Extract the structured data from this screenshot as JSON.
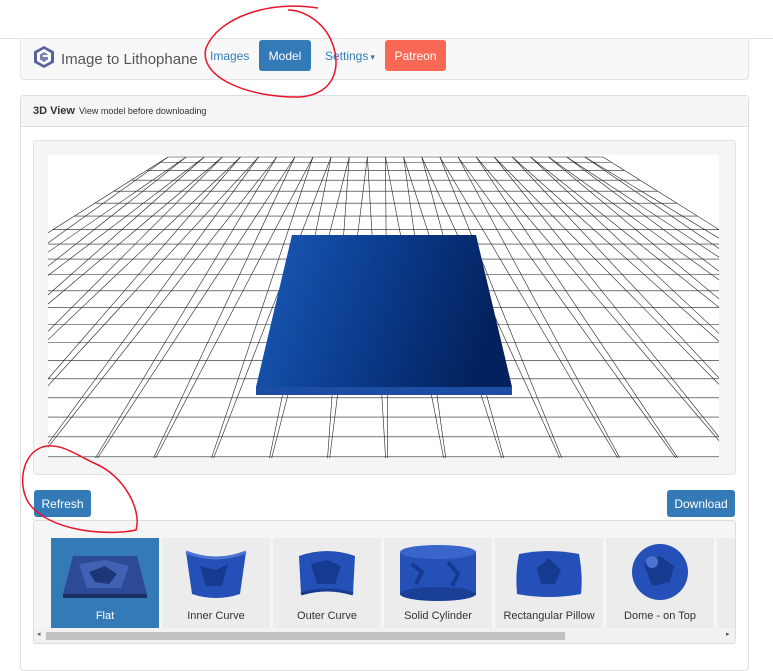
{
  "brand": {
    "title": "Image to Lithophane",
    "logo_icon": "lithophane-logo-icon"
  },
  "nav": {
    "images_label": "Images",
    "model_label": "Model",
    "settings_label": "Settings",
    "settings_caret": "▾",
    "patreon_label": "Patreon"
  },
  "panel": {
    "title": "3D View",
    "subtitle": "View model before downloading"
  },
  "actions": {
    "refresh_label": "Refresh",
    "download_label": "Download"
  },
  "shapes": {
    "items": [
      {
        "label": "Flat",
        "icon": "flat-shape-icon",
        "selected": true
      },
      {
        "label": "Inner Curve",
        "icon": "inner-curve-shape-icon",
        "selected": false
      },
      {
        "label": "Outer Curve",
        "icon": "outer-curve-shape-icon",
        "selected": false
      },
      {
        "label": "Solid Cylinder",
        "icon": "solid-cylinder-shape-icon",
        "selected": false
      },
      {
        "label": "Rectangular Pillow",
        "icon": "rectangular-pillow-shape-icon",
        "selected": false
      },
      {
        "label": "Dome - on Top",
        "icon": "dome-on-top-shape-icon",
        "selected": false
      }
    ],
    "scroll_left": "◂",
    "scroll_right": "▸"
  },
  "colors": {
    "primary": "#337ab7",
    "patreon": "#f96854",
    "annotation": "#e8142a",
    "model_blue": "#0a3a8a",
    "grid_line": "#222222"
  }
}
